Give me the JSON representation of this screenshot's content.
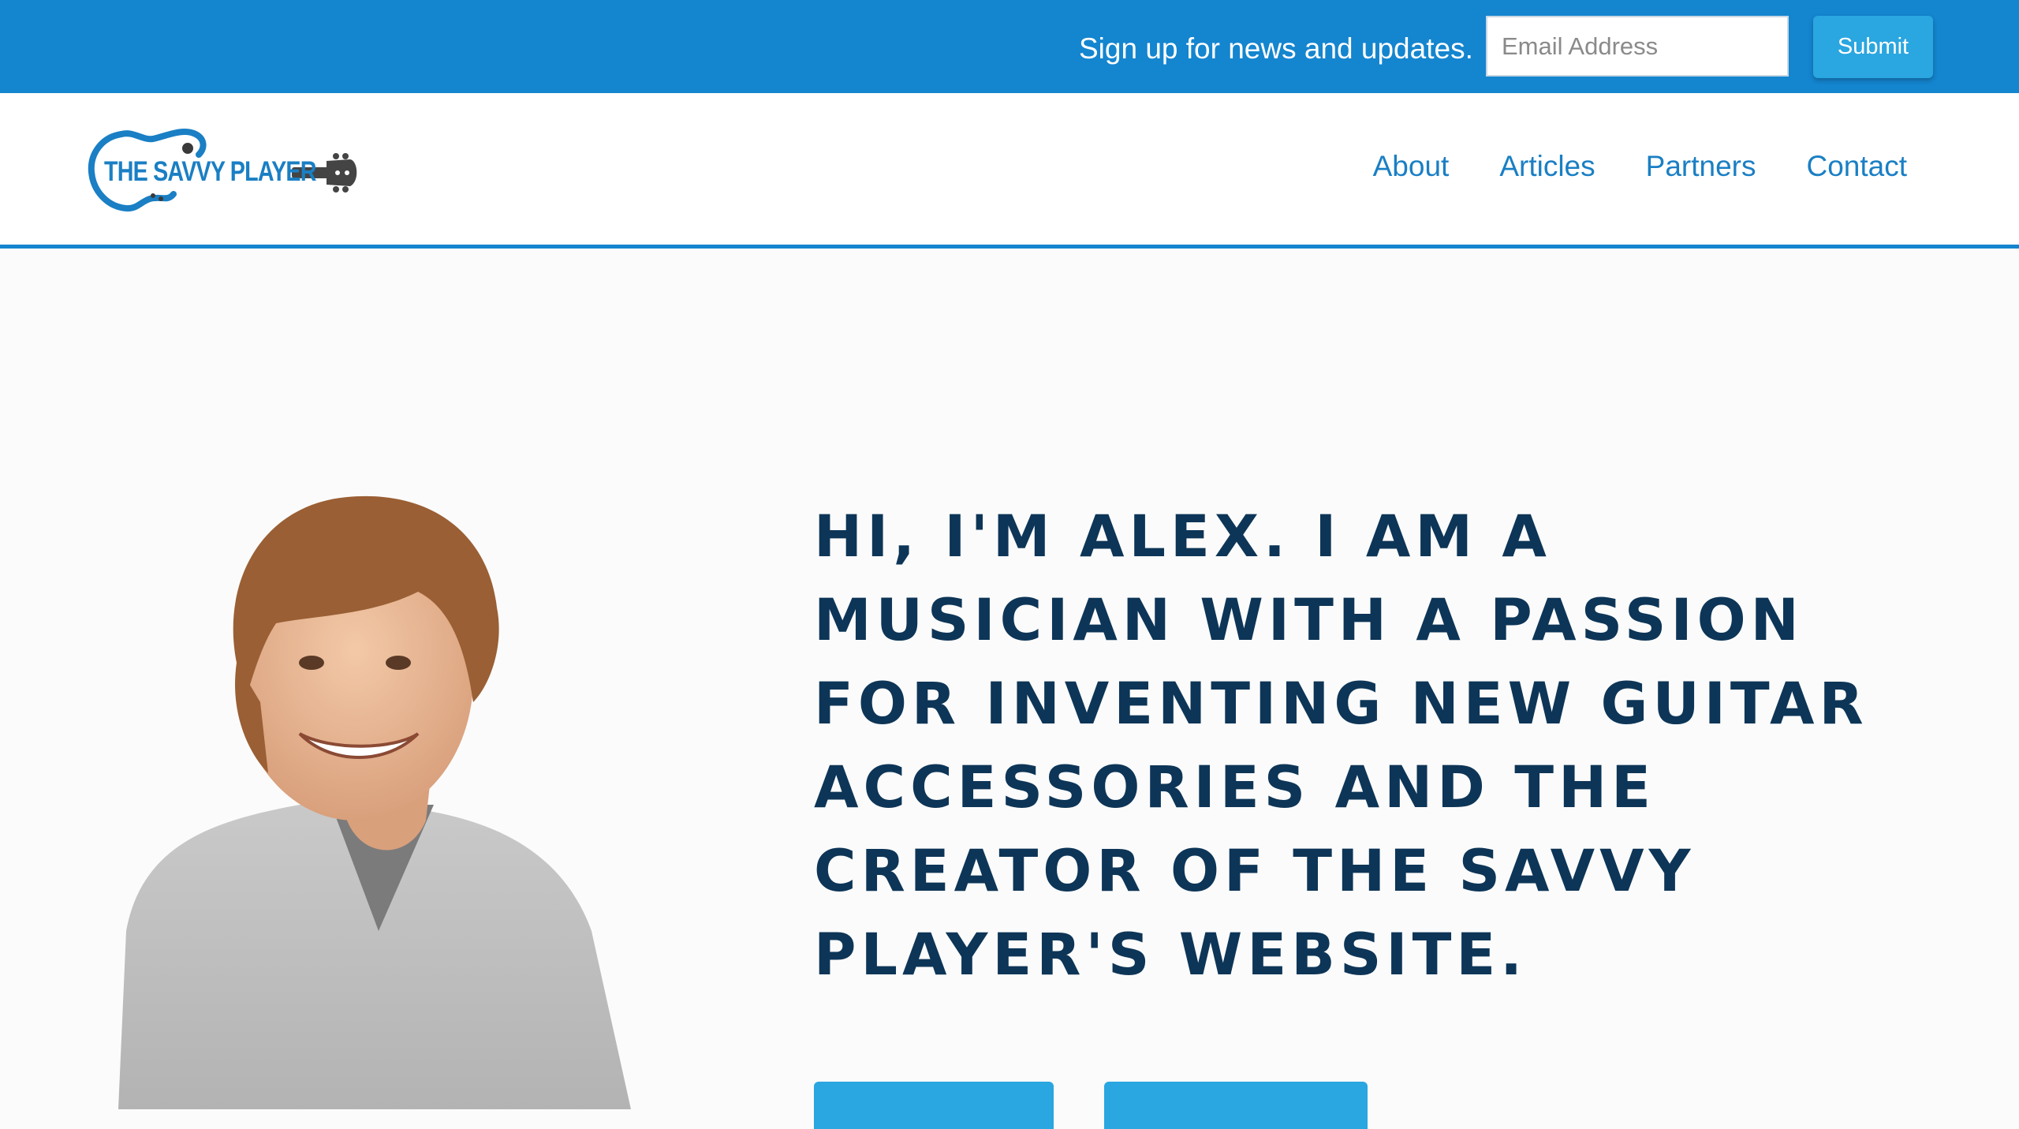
{
  "signup": {
    "text": "Sign up for news and updates.",
    "email_placeholder": "Email Address",
    "email_value": "",
    "submit_label": "Submit"
  },
  "logo": {
    "text": "THE SAVVY PLAYER"
  },
  "nav": {
    "items": [
      {
        "label": "About"
      },
      {
        "label": "Articles"
      },
      {
        "label": "Partners"
      },
      {
        "label": "Contact"
      }
    ]
  },
  "hero": {
    "headline": "HI, I'M ALEX. I AM A MUSICIAN WITH A PASSION FOR INVENTING NEW GUITAR ACCESSORIES AND THE CREATOR OF THE SAVVY PLAYER'S WEBSITE.",
    "cta_primary_label": "",
    "cta_secondary_label": ""
  },
  "colors": {
    "brand_blue": "#1485cf",
    "button_blue": "#2aa6e0",
    "headline_navy": "#0d3557",
    "page_background": "#fbfbfb"
  },
  "icons": {
    "logo": "guitar-logo-icon",
    "portrait": "person-photo"
  }
}
